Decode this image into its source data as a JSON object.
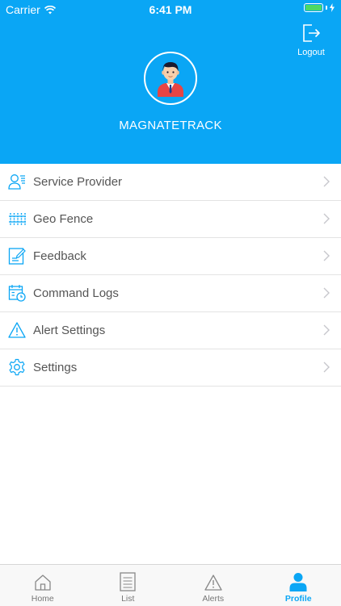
{
  "status_bar": {
    "carrier": "Carrier",
    "time": "6:41 PM"
  },
  "header": {
    "logout_label": "Logout",
    "username": "MAGNATETRACK"
  },
  "menu": {
    "items": [
      {
        "label": "Service Provider",
        "icon": "service-provider-icon"
      },
      {
        "label": "Geo Fence",
        "icon": "geo-fence-icon"
      },
      {
        "label": "Feedback",
        "icon": "feedback-icon"
      },
      {
        "label": "Command Logs",
        "icon": "command-logs-icon"
      },
      {
        "label": "Alert Settings",
        "icon": "alert-settings-icon"
      },
      {
        "label": "Settings",
        "icon": "settings-icon"
      }
    ]
  },
  "tabbar": {
    "tabs": [
      {
        "label": "Home",
        "icon": "home-icon"
      },
      {
        "label": "List",
        "icon": "list-icon"
      },
      {
        "label": "Alerts",
        "icon": "alerts-icon"
      },
      {
        "label": "Profile",
        "icon": "profile-icon",
        "active": true
      }
    ]
  },
  "colors": {
    "primary": "#0aa6f5",
    "battery": "#4cd964"
  }
}
